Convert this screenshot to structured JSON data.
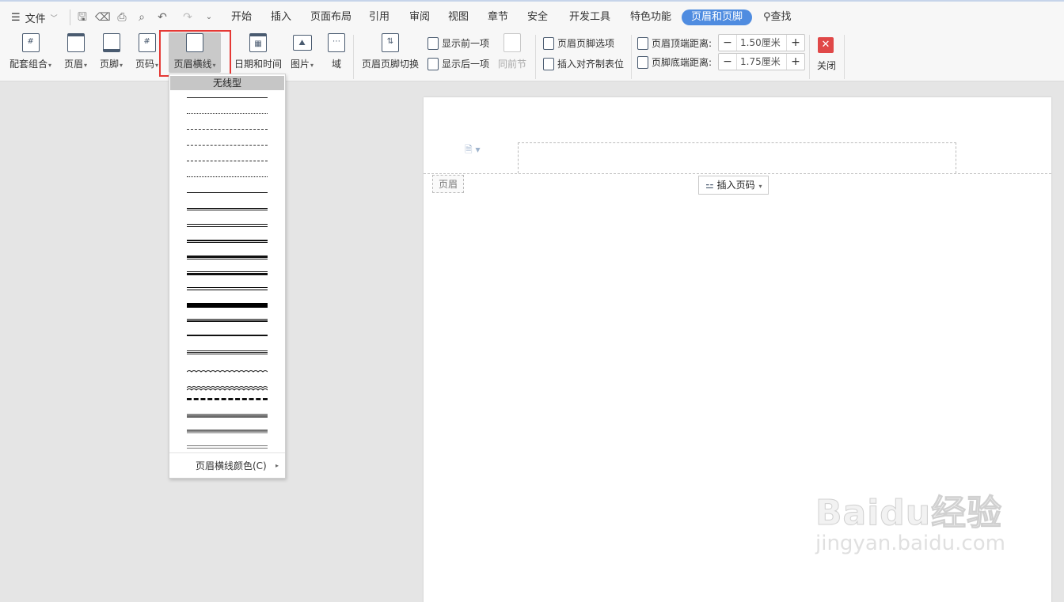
{
  "menubar": {
    "file_label": "文件",
    "tabs": [
      "开始",
      "插入",
      "页面布局",
      "引用",
      "审阅",
      "视图",
      "章节",
      "安全",
      "开发工具",
      "特色功能",
      "页眉和页脚"
    ],
    "active_tab": "页眉和页脚",
    "search_label": "查找"
  },
  "ribbon": {
    "combo": "配套组合",
    "header": "页眉",
    "footer": "页脚",
    "page_number": "页码",
    "header_line": "页眉横线",
    "date_time": "日期和时间",
    "picture": "图片",
    "field": "域",
    "switch": "页眉页脚切换",
    "show_prev": "显示前一项",
    "show_next": "显示后一项",
    "same_as_prev": "同前节",
    "hf_options": "页眉页脚选项",
    "insert_align_tab": "插入对齐制表位",
    "header_top_label": "页眉顶端距离:",
    "header_top_value": "1.50厘米",
    "footer_bottom_label": "页脚底端距离:",
    "footer_bottom_value": "1.75厘米",
    "close": "关闭"
  },
  "dropdown": {
    "none_label": "无线型",
    "line_styles": [
      "solid-thin",
      "dotted",
      "dashed-short",
      "dashed",
      "dash-dot",
      "dash-dot-dot",
      "solid",
      "double-thin",
      "double",
      "triple",
      "thick-thin",
      "thin-thick",
      "thick",
      "thick-thin-thick",
      "thin-thick-thin",
      "double-medium",
      "triple-thin",
      "wavy",
      "double-wavy",
      "dash-dot-stroked",
      "emboss",
      "engrave",
      "outset"
    ],
    "color_label": "页眉横线颜色(C)"
  },
  "document": {
    "header_tag": "页眉",
    "insert_page_number": "插入页码"
  },
  "watermark": {
    "brand": "Baidu经验",
    "url": "jingyan.baidu.com"
  }
}
